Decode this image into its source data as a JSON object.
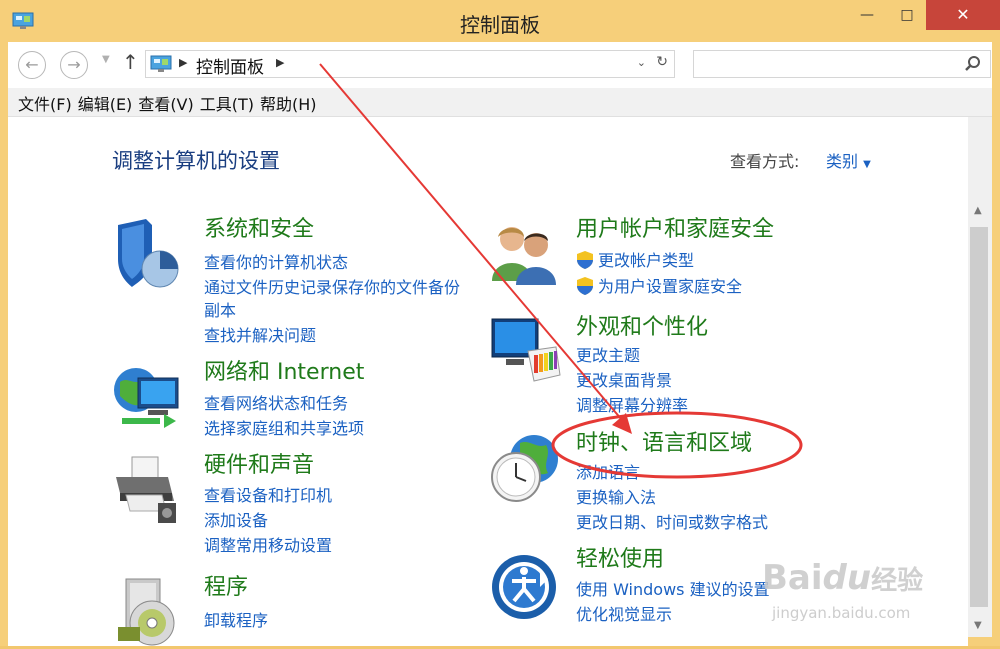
{
  "window": {
    "title": "控制面板"
  },
  "address": {
    "path": "控制面板",
    "search_placeholder": ""
  },
  "menu": [
    "文件(F)",
    "编辑(E)",
    "查看(V)",
    "工具(T)",
    "帮助(H)"
  ],
  "page": {
    "heading": "调整计算机的设置",
    "view_by_label": "查看方式:",
    "view_by_value": "类别"
  },
  "categories": {
    "system": {
      "title": "系统和安全",
      "links": [
        "查看你的计算机状态",
        "通过文件历史记录保存你的文件备份",
        "副本",
        "查找并解决问题"
      ]
    },
    "network": {
      "title": "网络和 Internet",
      "links": [
        "查看网络状态和任务",
        "选择家庭组和共享选项"
      ]
    },
    "hardware": {
      "title": "硬件和声音",
      "links": [
        "查看设备和打印机",
        "添加设备",
        "调整常用移动设置"
      ]
    },
    "programs": {
      "title": "程序",
      "links": [
        "卸载程序"
      ]
    },
    "accounts": {
      "title": "用户帐户和家庭安全",
      "links": [
        "更改帐户类型",
        "为用户设置家庭安全"
      ]
    },
    "appearance": {
      "title": "外观和个性化",
      "links": [
        "更改主题",
        "更改桌面背景",
        "调整屏幕分辨率"
      ]
    },
    "clock": {
      "title": "时钟、语言和区域",
      "links": [
        "添加语言",
        "更换输入法",
        "更改日期、时间或数字格式"
      ]
    },
    "ease": {
      "title": "轻松使用",
      "links": [
        "使用 Windows 建议的设置",
        "优化视觉显示"
      ]
    }
  },
  "annotation": {
    "color": "#e53935"
  },
  "watermark": {
    "logo_a": "Bai",
    "logo_b": "du",
    "logo_c": "经验",
    "url": "jingyan.baidu.com"
  }
}
